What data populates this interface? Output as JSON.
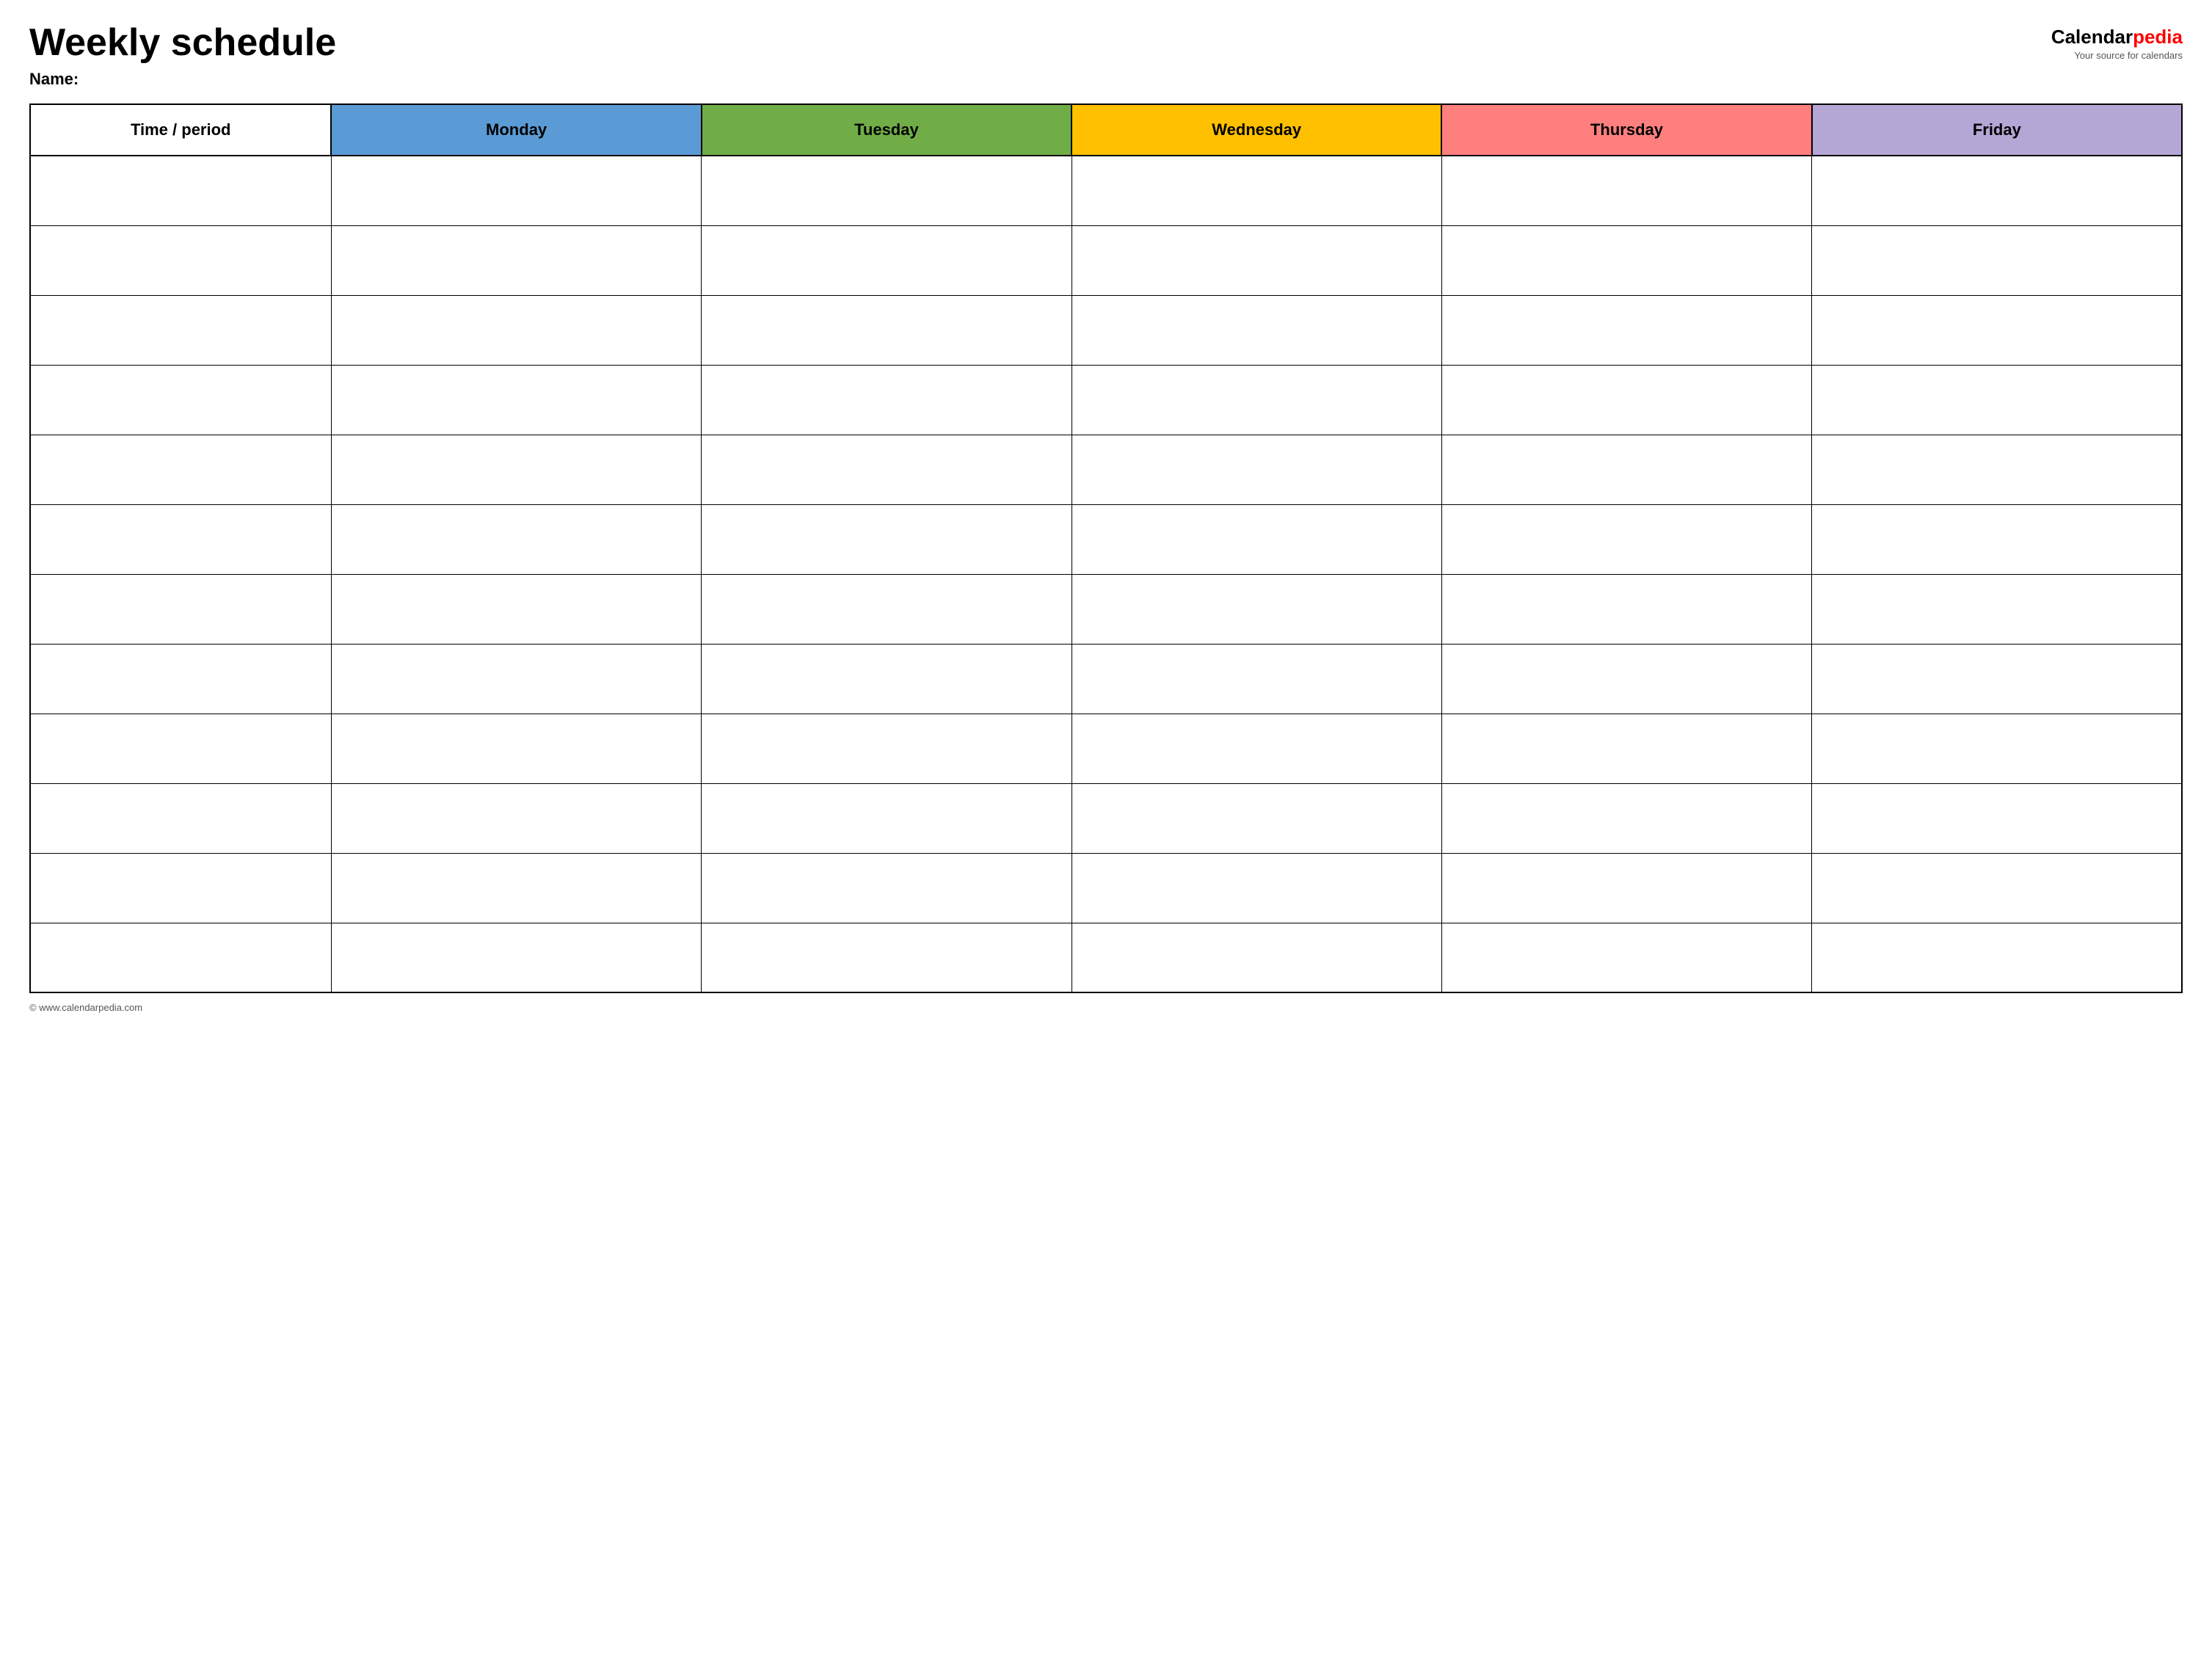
{
  "header": {
    "title": "Weekly schedule",
    "name_label": "Name:",
    "logo": {
      "calendar": "Calendar",
      "pedia": "pedia",
      "tagline": "Your source for calendars"
    }
  },
  "table": {
    "columns": [
      {
        "id": "time",
        "label": "Time / period",
        "color": "#ffffff"
      },
      {
        "id": "monday",
        "label": "Monday",
        "color": "#5b9bd5"
      },
      {
        "id": "tuesday",
        "label": "Tuesday",
        "color": "#70ad47"
      },
      {
        "id": "wednesday",
        "label": "Wednesday",
        "color": "#ffc000"
      },
      {
        "id": "thursday",
        "label": "Thursday",
        "color": "#ff7f7f"
      },
      {
        "id": "friday",
        "label": "Friday",
        "color": "#b4a7d6"
      }
    ],
    "rows": 12
  },
  "footer": {
    "text": "© www.calendarpedia.com"
  }
}
